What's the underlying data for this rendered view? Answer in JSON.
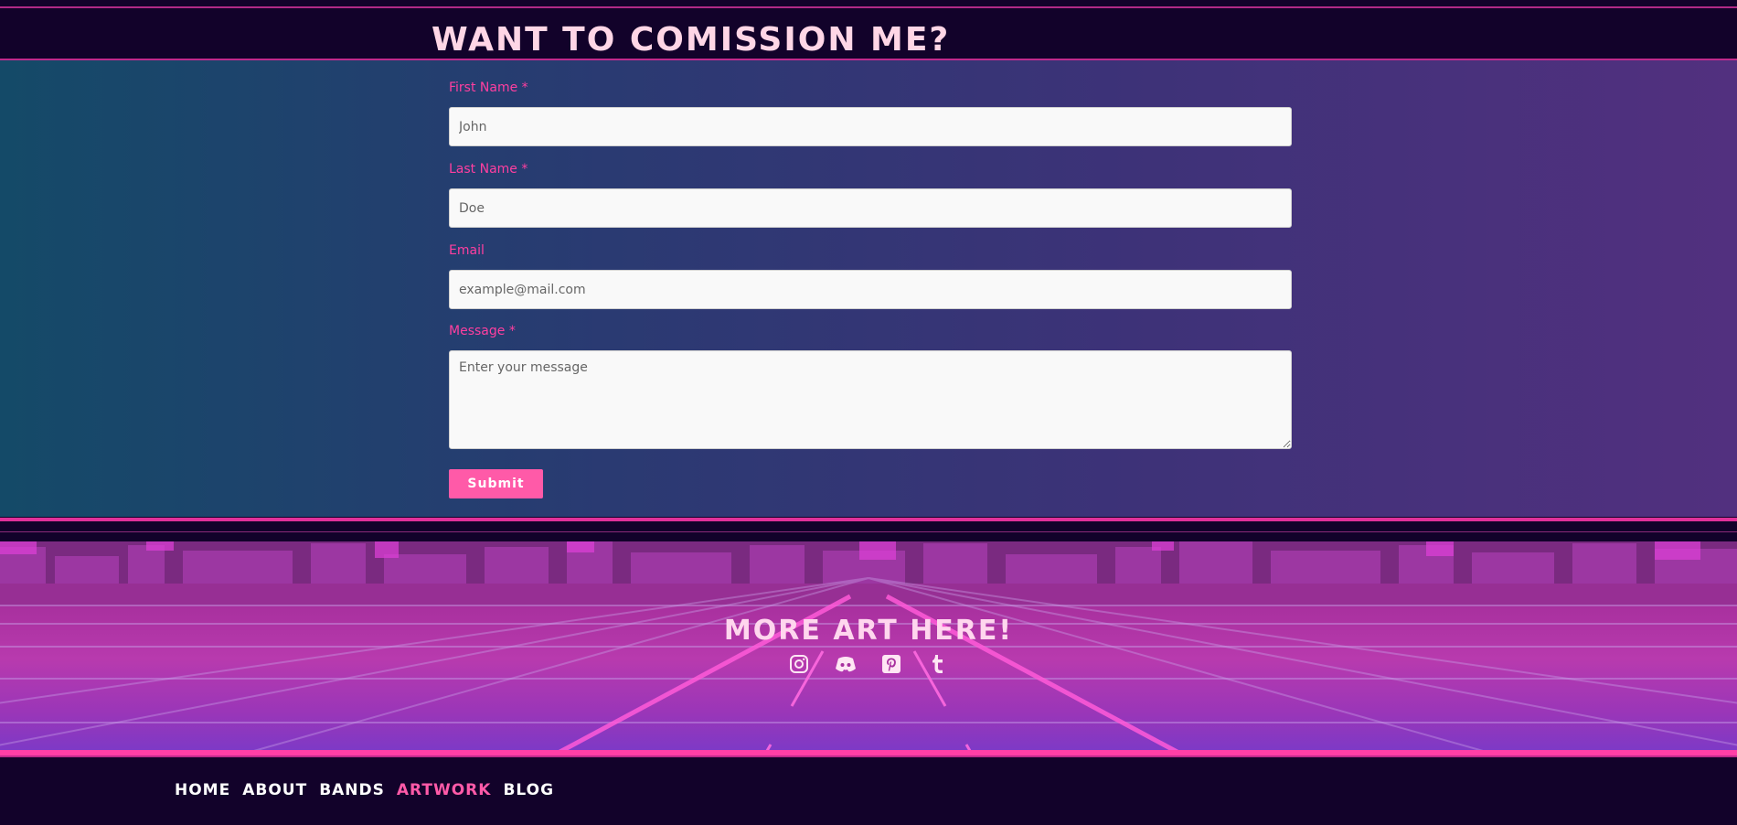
{
  "header": {
    "title": "WANT TO COMISSION ME?"
  },
  "form": {
    "first_name": {
      "label": "First Name",
      "required_mark": "*",
      "placeholder": "John"
    },
    "last_name": {
      "label": "Last Name",
      "required_mark": "*",
      "placeholder": "Doe"
    },
    "email": {
      "label": "Email",
      "placeholder": "example@mail.com"
    },
    "message": {
      "label": "Message",
      "required_mark": "*",
      "placeholder": "Enter your message"
    },
    "submit_label": "Submit"
  },
  "footer": {
    "heading": "MORE ART HERE!",
    "social": [
      "instagram-icon",
      "discord-icon",
      "pinterest-icon",
      "tumblr-icon"
    ]
  },
  "nav": {
    "items": [
      {
        "label": "HOME",
        "active": false
      },
      {
        "label": "ABOUT",
        "active": false
      },
      {
        "label": "BANDS",
        "active": false
      },
      {
        "label": "ARTWORK",
        "active": true
      },
      {
        "label": "BLOG",
        "active": false
      }
    ]
  },
  "colors": {
    "accent_pink": "#ff5aa8",
    "label_pink": "#ff3fa0",
    "dark_bg": "#12022a",
    "title_text": "#ffd6e6"
  }
}
